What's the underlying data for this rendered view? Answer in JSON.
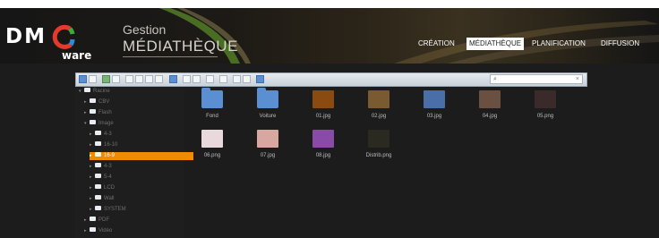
{
  "brand": {
    "logo_text": "DMC",
    "logo_ware": "ware",
    "section_small": "Gestion",
    "section_big": "MÉDIATHÈQUE"
  },
  "nav": [
    {
      "label": "CRÉATION",
      "active": false
    },
    {
      "label": "MÉDIATHÈQUE",
      "active": true
    },
    {
      "label": "PLANIFICATION",
      "active": false
    },
    {
      "label": "DIFFUSION",
      "active": false
    }
  ],
  "toolbar": {
    "buttons": [
      "back-icon",
      "forward-icon",
      "up-icon",
      "refresh-icon",
      "copy-icon",
      "cut-icon",
      "paste-icon",
      "info-icon",
      "new-folder-icon",
      "upload-icon",
      "rename-icon",
      "delete-icon",
      "edit-icon",
      "view-icons-icon",
      "view-list-icon",
      "help-icon"
    ],
    "search_icon": "⌕",
    "search_clear": "×",
    "search_value": ""
  },
  "tree": [
    {
      "label": "Racine",
      "level": 0,
      "expanded": true,
      "selected": false
    },
    {
      "label": "CBV",
      "level": 1,
      "expanded": false,
      "selected": false
    },
    {
      "label": "Flash",
      "level": 1,
      "expanded": false,
      "selected": false
    },
    {
      "label": "Image",
      "level": 1,
      "expanded": true,
      "selected": false
    },
    {
      "label": "4-3",
      "level": 2,
      "expanded": false,
      "selected": false
    },
    {
      "label": "16-10",
      "level": 2,
      "expanded": false,
      "selected": false
    },
    {
      "label": "16-9",
      "level": 2,
      "expanded": false,
      "selected": true
    },
    {
      "label": "4-3",
      "level": 2,
      "expanded": false,
      "selected": false
    },
    {
      "label": "5-4",
      "level": 2,
      "expanded": false,
      "selected": false
    },
    {
      "label": "LCD",
      "level": 2,
      "expanded": false,
      "selected": false
    },
    {
      "label": "Wall",
      "level": 2,
      "expanded": false,
      "selected": false
    },
    {
      "label": "SYSTEM",
      "level": 2,
      "expanded": false,
      "selected": false
    },
    {
      "label": "PDF",
      "level": 1,
      "expanded": false,
      "selected": false
    },
    {
      "label": "Vidéo",
      "level": 1,
      "expanded": false,
      "selected": false
    }
  ],
  "files": [
    {
      "name": "Fond",
      "kind": "folder",
      "color": "#5b8fd4"
    },
    {
      "name": "Voiture",
      "kind": "folder",
      "color": "#5b8fd4"
    },
    {
      "name": "01.jpg",
      "kind": "image",
      "color": "#8a4a10"
    },
    {
      "name": "02.jpg",
      "kind": "image",
      "color": "#7a5a30"
    },
    {
      "name": "03.jpg",
      "kind": "image",
      "color": "#4a6fa8"
    },
    {
      "name": "04.jpg",
      "kind": "image",
      "color": "#6a5040"
    },
    {
      "name": "05.png",
      "kind": "image",
      "color": "#3a2a2a"
    },
    {
      "name": "06.png",
      "kind": "image",
      "color": "#e9d8dc"
    },
    {
      "name": "07.jpg",
      "kind": "image",
      "color": "#d8a8a0"
    },
    {
      "name": "08.jpg",
      "kind": "image",
      "color": "#8a4aa8"
    },
    {
      "name": "Distrib.png",
      "kind": "image",
      "color": "#2a2a20"
    }
  ]
}
